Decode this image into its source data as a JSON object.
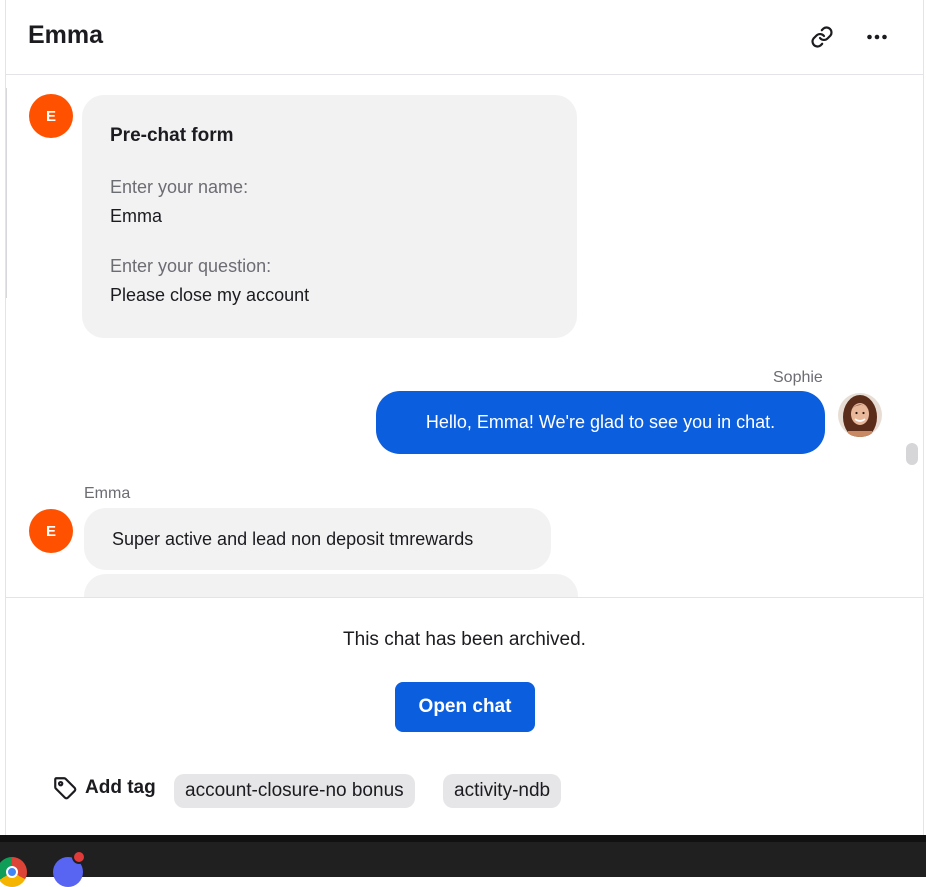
{
  "header": {
    "title": "Emma",
    "copy_link_icon": "link-icon",
    "more_icon": "more-horizontal-icon"
  },
  "prechat_form": {
    "avatar_initial": "E",
    "title": "Pre-chat form",
    "fields": [
      {
        "question": "Enter your name:",
        "answer": "Emma"
      },
      {
        "question": "Enter your question:",
        "answer": "Please close my account"
      }
    ]
  },
  "agent_message": {
    "sender": "Sophie",
    "text": "Hello, Emma! We're glad to see you in chat."
  },
  "customer_message": {
    "sender": "Emma",
    "avatar_initial": "E",
    "text": "Super active and lead non deposit tmrewards"
  },
  "footer": {
    "archived_text": "This chat has been archived.",
    "open_chat_label": "Open chat",
    "add_tag_label": "Add tag",
    "tags": [
      "account-closure-no bonus",
      "activity-ndb"
    ]
  },
  "colors": {
    "primary": "#0b5ede",
    "avatar": "#ff5100",
    "bubble": "#f2f2f3",
    "tag": "#e6e6e8"
  }
}
